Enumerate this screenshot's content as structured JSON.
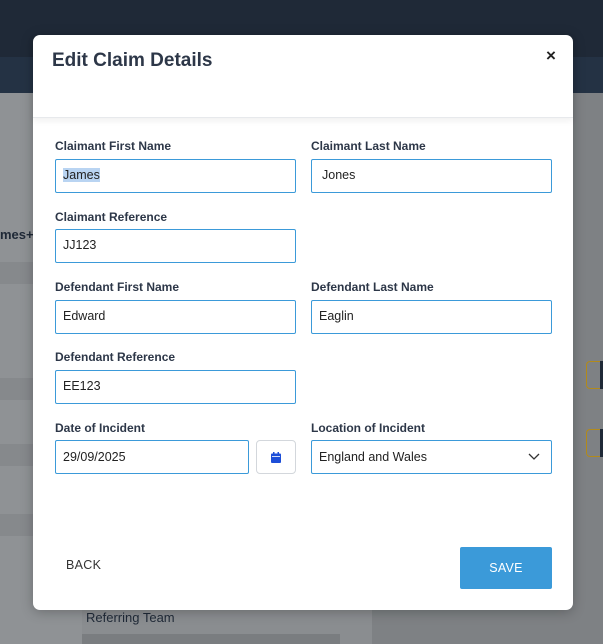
{
  "background": {
    "partial_text": "mes+e",
    "referring_team": "Referring Team"
  },
  "modal": {
    "title": "Edit Claim Details",
    "close_glyph": "×",
    "fields": {
      "claimant_first_name": {
        "label": "Claimant First Name",
        "value": "James"
      },
      "claimant_last_name": {
        "label": "Claimant Last Name",
        "value": "Jones"
      },
      "claimant_reference": {
        "label": "Claimant Reference",
        "value": "JJ123"
      },
      "defendant_first_name": {
        "label": "Defendant First Name",
        "value": "Edward"
      },
      "defendant_last_name": {
        "label": "Defendant Last Name",
        "value": "Eaglin"
      },
      "defendant_reference": {
        "label": "Defendant Reference",
        "value": "EE123"
      },
      "date_of_incident": {
        "label": "Date of Incident",
        "value": "29/09/2025"
      },
      "location_of_incident": {
        "label": "Location of Incident",
        "value": "England and Wales"
      }
    },
    "buttons": {
      "back": "BACK",
      "save": "SAVE"
    },
    "icons": {
      "calendar": "calendar-icon",
      "chevron": "chevron-down-icon",
      "close": "close-icon"
    },
    "colors": {
      "accent": "#3b9ad9",
      "calendar_icon": "#1d4ed8",
      "title": "#2d3748"
    }
  }
}
